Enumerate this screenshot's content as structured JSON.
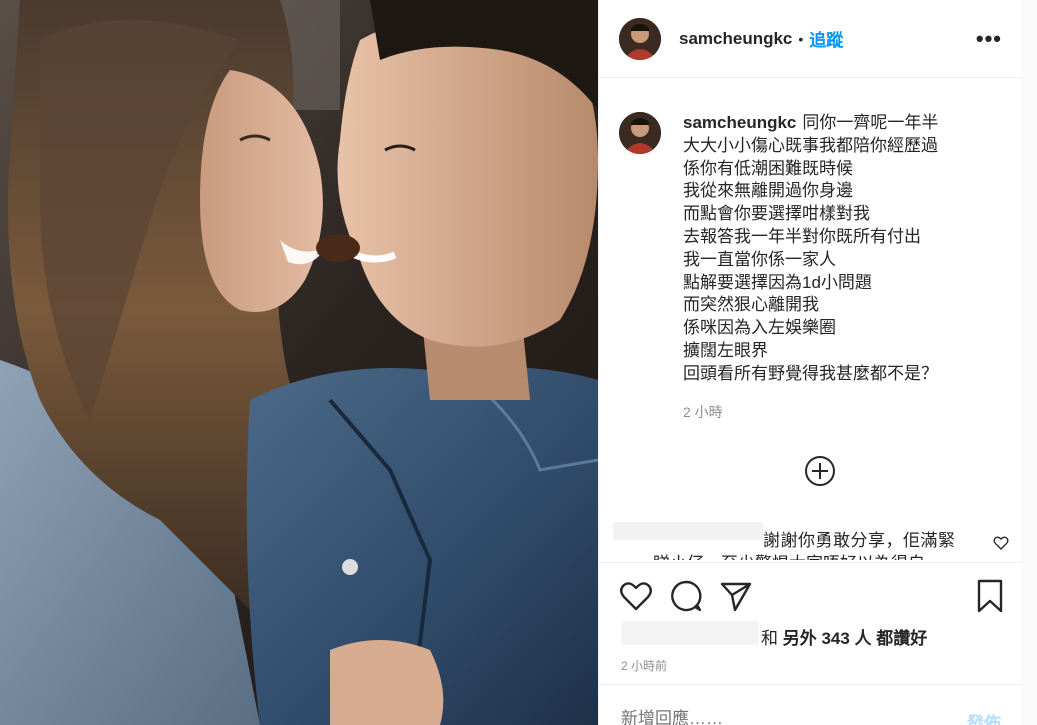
{
  "post": {
    "username": "samcheungkc",
    "follow_label": "追蹤",
    "separator": "•",
    "more_label": "•••"
  },
  "caption": {
    "username": "samcheungkc",
    "lines": [
      "同你一齊呢一年半",
      "大大小小傷心既事我都陪你經歷過",
      "係你有低潮困難既時候",
      "我從來無離開過你身邊",
      "而點會你要選擇咁樣對我",
      "去報答我一年半對你既所有付出",
      "我一直當你係一家人",
      "點解要選擇因為1d小問題",
      "而突然狠心離開我",
      "係咪因為入左娛樂圈",
      "擴闊左眼界",
      "回頭看所有野覺得我甚麼都不是？"
    ],
    "time": "2 小時"
  },
  "comment_preview": {
    "text": "謝謝你勇敢分享，佢滿緊",
    "text_cut": "睇小仔　至少警惕大家唔好以為得自"
  },
  "likes": {
    "prefix": "和",
    "bold": "另外 343 人",
    "suffix": "都讚好"
  },
  "posted_time": "2 小時前",
  "comment_box": {
    "placeholder": "新增回應……",
    "post_label": "發佈"
  },
  "icons": {
    "more": "more-horizontal-icon",
    "load_more": "plus-circle-icon",
    "like": "heart-icon",
    "comment": "comment-bubble-icon",
    "share": "paper-plane-icon",
    "save": "bookmark-icon"
  },
  "colors": {
    "link_blue": "#0095f6",
    "post_disabled": "#b2dffc",
    "muted": "#8e8e8e",
    "text": "#262626"
  }
}
